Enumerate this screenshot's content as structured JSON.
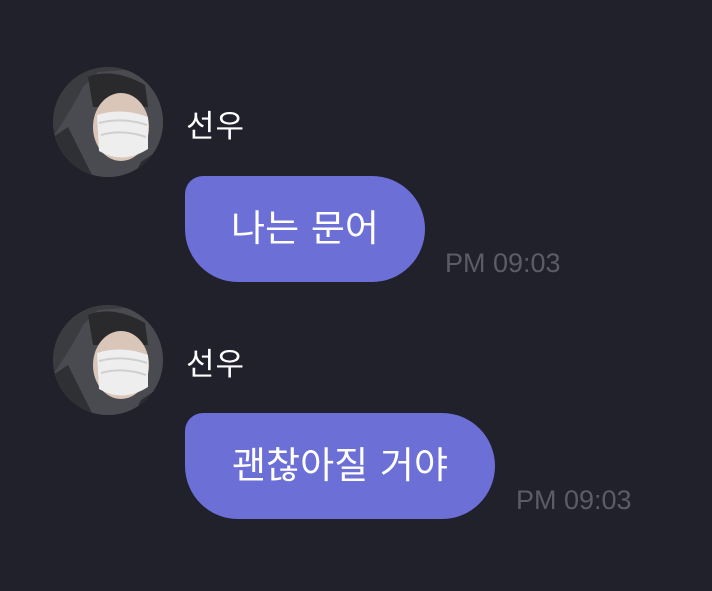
{
  "colors": {
    "background": "#21212b",
    "bubble": "#6b6fd6",
    "text": "#ffffff",
    "timestamp": "#5c5c68"
  },
  "messages": [
    {
      "sender": "선우",
      "avatar": "profile-photo",
      "text": "나는 문어",
      "time": "PM 09:03"
    },
    {
      "sender": "선우",
      "avatar": "profile-photo",
      "text": "괜찮아질 거야",
      "time": "PM 09:03"
    }
  ]
}
